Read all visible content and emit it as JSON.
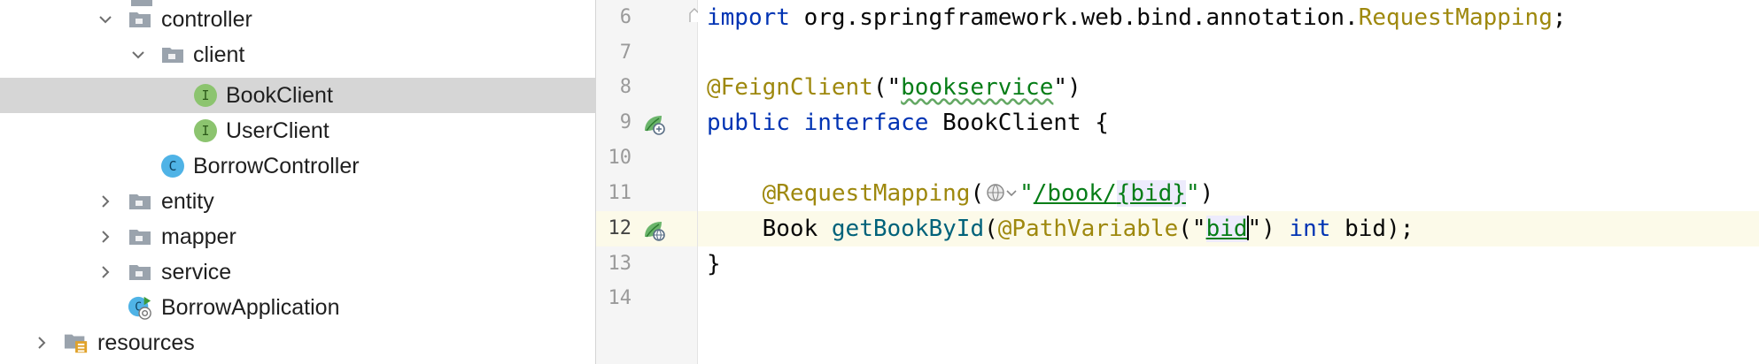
{
  "tree": {
    "items": [
      {
        "label": "controller",
        "kind": "folder",
        "expanded": true
      },
      {
        "label": "client",
        "kind": "folder",
        "expanded": true
      },
      {
        "label": "BookClient",
        "kind": "interface",
        "badge": "I",
        "selected": true
      },
      {
        "label": "UserClient",
        "kind": "interface",
        "badge": "I"
      },
      {
        "label": "BorrowController",
        "kind": "class",
        "badge": "C"
      },
      {
        "label": "entity",
        "kind": "folder",
        "expanded": false
      },
      {
        "label": "mapper",
        "kind": "folder",
        "expanded": false
      },
      {
        "label": "service",
        "kind": "folder",
        "expanded": false
      },
      {
        "label": "BorrowApplication",
        "kind": "spring-boot-class"
      },
      {
        "label": "resources",
        "kind": "resources-folder",
        "expanded": false
      }
    ]
  },
  "editor": {
    "line_numbers": [
      "6",
      "7",
      "8",
      "9",
      "10",
      "11",
      "12",
      "13",
      "14"
    ],
    "current_line": "12",
    "lines": {
      "l6": {
        "kw": "import",
        "pkg": " org.springframework.web.bind.annotation.",
        "cls": "RequestMapping",
        "semi": ";"
      },
      "l8": {
        "ann": "@FeignClient",
        "open": "(\"",
        "str": "bookservice",
        "close": "\")"
      },
      "l9": {
        "kw1": "public",
        "kw2": "interface",
        "name": " BookClient {"
      },
      "l11": {
        "ann": "@RequestMapping",
        "open": "(",
        "q1": "\"",
        "path": "/book/",
        "param": "{bid}",
        "q2": "\"",
        "close": ")"
      },
      "l12": {
        "type": "Book ",
        "meth": "getBookById",
        "open": "(",
        "ann": "@PathVariable",
        "popen": "(\"",
        "param": "bid",
        "pclose": "\")",
        "kw": "int",
        "rest": " bid);"
      },
      "l13": {
        "brace": "}"
      }
    }
  },
  "colors": {
    "selection": "#d6d6d6",
    "keyword": "#0033b3",
    "annotation": "#9e880d",
    "string": "#067d17",
    "method": "#00627a",
    "current_line": "#fcfae9"
  }
}
